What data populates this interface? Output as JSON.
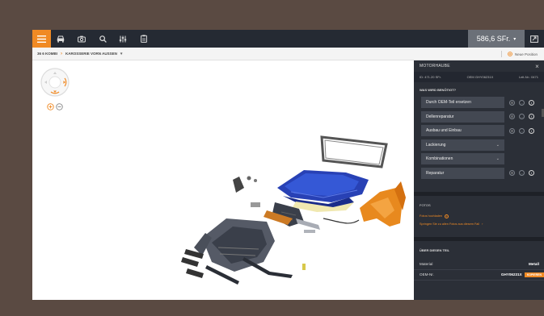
{
  "topbar": {
    "icons": [
      "menu-icon",
      "car-icon",
      "camera-icon",
      "search-icon",
      "sliders-icon",
      "clipboard-icon"
    ],
    "price": "586,6 SFr.",
    "price_caret": "▾",
    "accent": "#f08a24"
  },
  "breadcrumb": {
    "vehicle": "36 6 KOMBI",
    "section": "KAROSSERIE VORN AUSSEN",
    "dropdown_caret": "▾",
    "new_position": "Neue Position"
  },
  "panel": {
    "title": "MOTORHAUBE",
    "close": "×",
    "info": {
      "id": "ID: 471.20 SFr.",
      "oem": "OEM GHY06231X",
      "lsnr": "Leit-Nr.: 0471"
    },
    "needed_title": "WAS WIRD BENÖTIGT?",
    "options": [
      {
        "label": "Durch OEM-Teil ersetzen",
        "kind": "icons"
      },
      {
        "label": "Dellenreparatur",
        "kind": "icons"
      },
      {
        "label": "Ausbau und Einbau",
        "kind": "icons"
      },
      {
        "label": "Lackierung",
        "kind": "dropdown"
      },
      {
        "label": "Kombinationen",
        "kind": "dropdown"
      },
      {
        "label": "Reparatur",
        "kind": "icons"
      }
    ],
    "fotos_title": "FOTOS",
    "fotos_add": "Fotos hochladen",
    "fotos_all": "Springen Sie zu allen Fotos aus diesem Fall",
    "about_title": "ÜBER DIESEN TEIL",
    "props": [
      {
        "key": "Material",
        "value": "Metall"
      },
      {
        "key": "OEM-Nr.",
        "value": "GHY06231X",
        "tag": "KOPIEREN"
      }
    ]
  }
}
